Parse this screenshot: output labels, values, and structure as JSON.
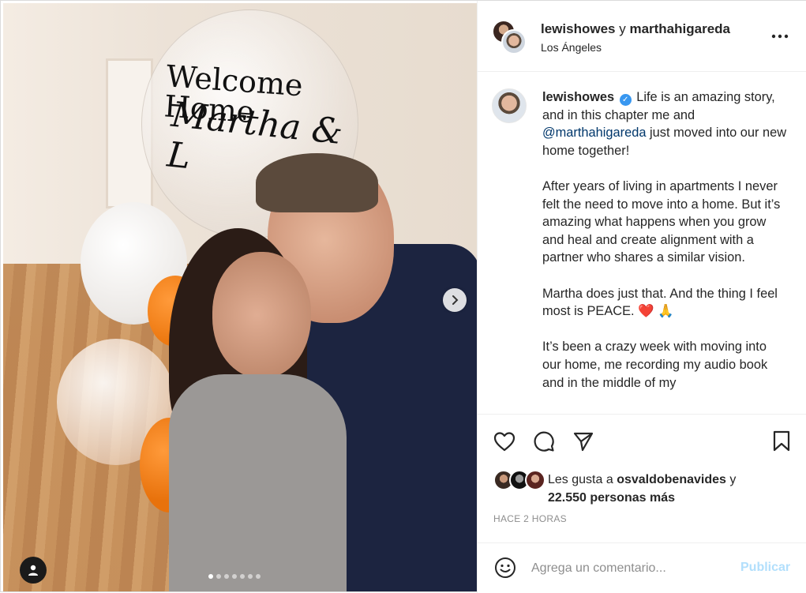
{
  "post": {
    "photo_text": {
      "line1": "Welcome Home",
      "line2": "Martha & L"
    },
    "carousel": {
      "slide_count": 7,
      "active_index": 0
    },
    "next_icon": "chevron-right-icon",
    "tag_icon": "user-icon"
  },
  "header": {
    "user1": "lewishowes",
    "connector": "y",
    "user2": "marthahigareda",
    "location": "Los Ángeles",
    "more_icon": "more-icon"
  },
  "caption": {
    "username": "lewishowes",
    "verified_icon": "verified-badge-icon",
    "text_start": "Life is an amazing story, and in this chapter me and",
    "mention": "@marthahigareda",
    "text_end": "just moved into our new home together!",
    "para2": "After years of living in apartments I never felt the need to move into a home. But it’s amazing what happens when you grow and heal and create alignment with a partner who shares a similar vision.",
    "para3": "Martha does just that. And the thing I feel most is PEACE.",
    "para3_emojis": "❤️ 🙏",
    "para4": "It’s been a crazy week with moving into our home, me recording my audio book and in the middle of my"
  },
  "actions": {
    "like_icon": "heart-icon",
    "comment_icon": "comment-icon",
    "share_icon": "share-icon",
    "save_icon": "bookmark-icon"
  },
  "likes": {
    "prefix": "Les gusta a",
    "user": "osvaldobenavides",
    "connector": "y",
    "count": "22.550 personas más"
  },
  "timestamp": "HACE 2 HORAS",
  "comment": {
    "emoji_icon": "emoji-icon",
    "placeholder": "Agrega un comentario...",
    "publish_label": "Publicar"
  },
  "colors": {
    "accent": "#0095f6",
    "publish_disabled": "#b2dffc",
    "verified": "#3897f0",
    "mention": "#00376b"
  }
}
